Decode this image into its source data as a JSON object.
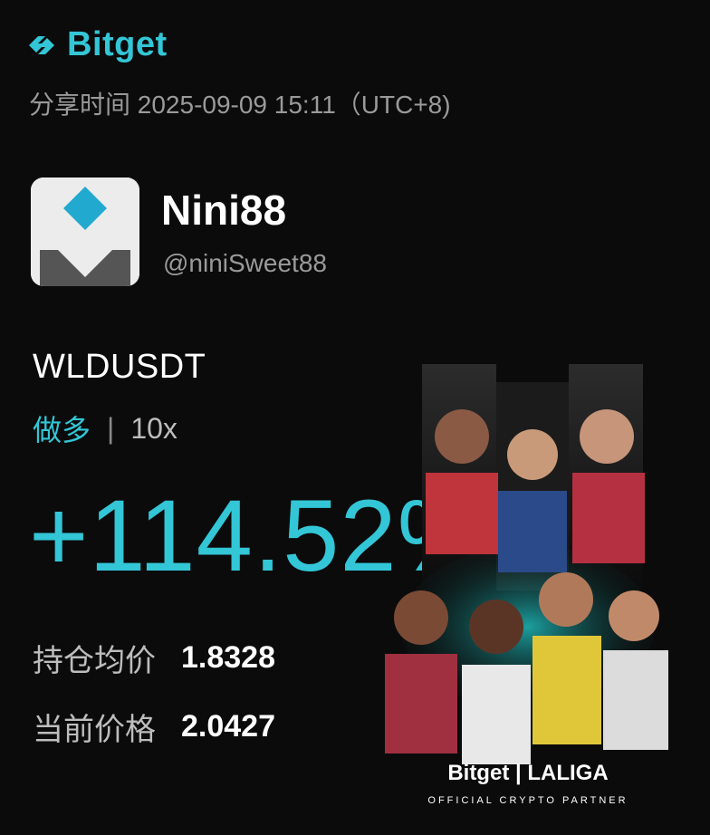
{
  "brand": {
    "name": "Bitget",
    "color": "#33c6d6"
  },
  "share": {
    "time_text": "分享时间 2025-09-09 15:11（UTC+8)"
  },
  "user": {
    "display_name": "Nini88",
    "handle": "@niniSweet88"
  },
  "trade": {
    "pair": "WLDUSDT",
    "side": "做多",
    "separator": "|",
    "leverage": "10x",
    "roi": "+114.52%",
    "entry_label": "持仓均价",
    "entry_price": "1.8328",
    "current_label": "当前价格",
    "current_price": "2.0427"
  },
  "promo": {
    "brand_line": "Bitget | LALIGA",
    "tagline": "OFFICIAL CRYPTO PARTNER"
  },
  "colors": {
    "background": "#0b0b0b",
    "accent": "#33c6d6",
    "muted": "#9a9a9a"
  }
}
